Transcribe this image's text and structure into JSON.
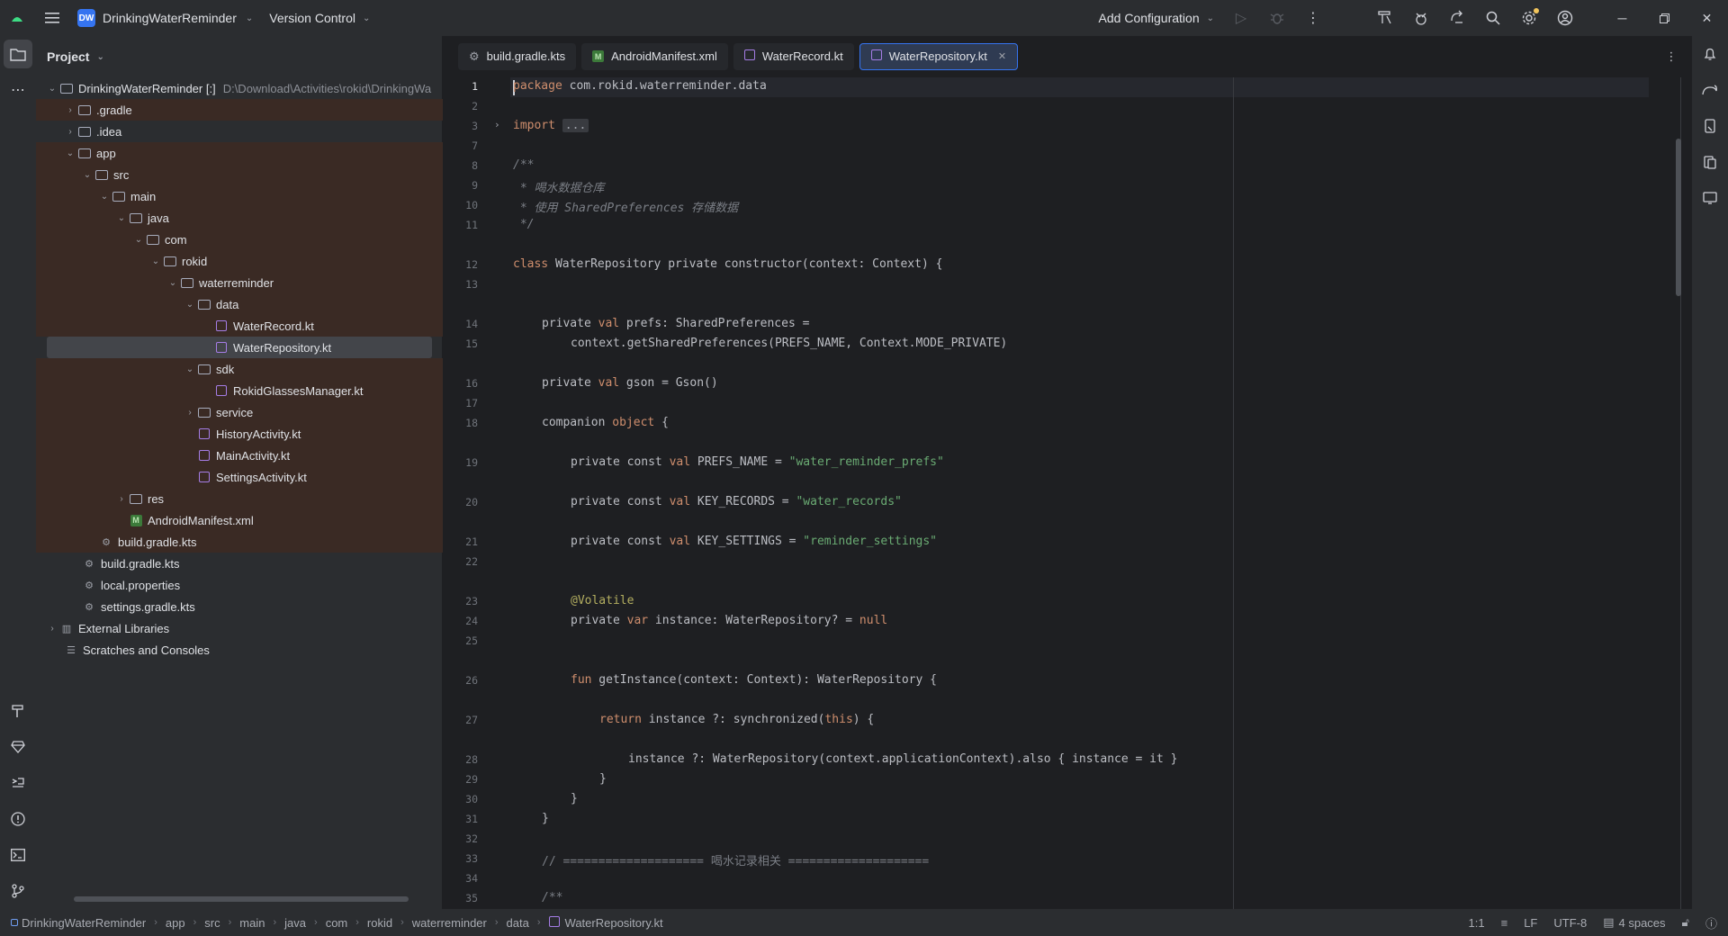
{
  "titlebar": {
    "project_badge": "DW",
    "project_name": "DrinkingWaterReminder",
    "version_control": "Version Control",
    "add_configuration": "Add Configuration"
  },
  "project_panel": {
    "title": "Project",
    "root_name": "DrinkingWaterReminder [:]",
    "root_path": "D:\\Download\\Activities\\rokid\\DrinkingWa",
    "items": [
      {
        "label": ".gradle"
      },
      {
        "label": ".idea"
      },
      {
        "label": "app"
      },
      {
        "label": "src"
      },
      {
        "label": "main"
      },
      {
        "label": "java"
      },
      {
        "label": "com"
      },
      {
        "label": "rokid"
      },
      {
        "label": "waterreminder"
      },
      {
        "label": "data"
      },
      {
        "label": "WaterRecord.kt"
      },
      {
        "label": "WaterRepository.kt"
      },
      {
        "label": "sdk"
      },
      {
        "label": "RokidGlassesManager.kt"
      },
      {
        "label": "service"
      },
      {
        "label": "HistoryActivity.kt"
      },
      {
        "label": "MainActivity.kt"
      },
      {
        "label": "SettingsActivity.kt"
      },
      {
        "label": "res"
      },
      {
        "label": "AndroidManifest.xml"
      },
      {
        "label": "build.gradle.kts"
      },
      {
        "label": "build.gradle.kts"
      },
      {
        "label": "local.properties"
      },
      {
        "label": "settings.gradle.kts"
      },
      {
        "label": "External Libraries"
      },
      {
        "label": "Scratches and Consoles"
      }
    ]
  },
  "tabs": [
    {
      "label": "build.gradle.kts"
    },
    {
      "label": "AndroidManifest.xml"
    },
    {
      "label": "WaterRecord.kt"
    },
    {
      "label": "WaterRepository.kt"
    }
  ],
  "code": {
    "line_numbers": [
      "1",
      "2",
      "3",
      "7",
      "8",
      "9",
      "10",
      "11",
      "12",
      "13",
      "14",
      "15",
      "16",
      "17",
      "18",
      "19",
      "20",
      "21",
      "22",
      "23",
      "24",
      "25",
      "26",
      "27",
      "28",
      "29",
      "30",
      "31",
      "32",
      "33",
      "34",
      "35"
    ],
    "lines": {
      "l1_kw": "package",
      "l1_rest": " com.rokid.waterreminder.data",
      "l3_kw": "import",
      "l3_fold": "...",
      "l8": "/**",
      "l9": " * 喝水数据仓库",
      "l10": " * 使用 SharedPreferences 存储数据",
      "l11": " */",
      "l12_kw": "class",
      "l12_rest": " WaterRepository private constructor(context: Context) {",
      "l14_a": "private ",
      "l14_kw": "val",
      "l14_b": " prefs: SharedPreferences =",
      "l15": "context.getSharedPreferences(PREFS_NAME, Context.MODE_PRIVATE)",
      "l16_a": "private ",
      "l16_kw": "val",
      "l16_b": " gson = Gson()",
      "l18_a": "companion ",
      "l18_kw": "object",
      "l18_b": " {",
      "l19_a": "private const ",
      "l19_kw": "val",
      "l19_b": " PREFS_NAME = ",
      "l19_str": "\"water_reminder_prefs\"",
      "l20_a": "private const ",
      "l20_kw": "val",
      "l20_b": " KEY_RECORDS = ",
      "l20_str": "\"water_records\"",
      "l21_a": "private const ",
      "l21_kw": "val",
      "l21_b": " KEY_SETTINGS = ",
      "l21_str": "\"reminder_settings\"",
      "l23": "@Volatile",
      "l24_a": "private ",
      "l24_kw": "var",
      "l24_b": " instance: WaterRepository? = ",
      "l24_null": "null",
      "l26_kw": "fun",
      "l26_b": " getInstance(context: Context): WaterRepository {",
      "l27_kw": "return",
      "l27_b": " instance ?: synchronized(",
      "l27_this": "this",
      "l27_c": ") {",
      "l28": "instance ?: WaterRepository(context.applicationContext).also { instance = it }",
      "l29": "}",
      "l30": "}",
      "l31": "}",
      "l33": "// ==================== 喝水记录相关 ====================",
      "l35": "/**"
    }
  },
  "statusbar": {
    "breadcrumbs": [
      "DrinkingWaterReminder",
      "app",
      "src",
      "main",
      "java",
      "com",
      "rokid",
      "waterreminder",
      "data",
      "WaterRepository.kt"
    ],
    "position": "1:1",
    "line_ending": "LF",
    "encoding": "UTF-8",
    "indent": "4 spaces"
  },
  "colors": {
    "accent": "#3574f0",
    "keyword": "#cf8e6d",
    "string": "#6aab73",
    "comment": "#7a7e85"
  }
}
